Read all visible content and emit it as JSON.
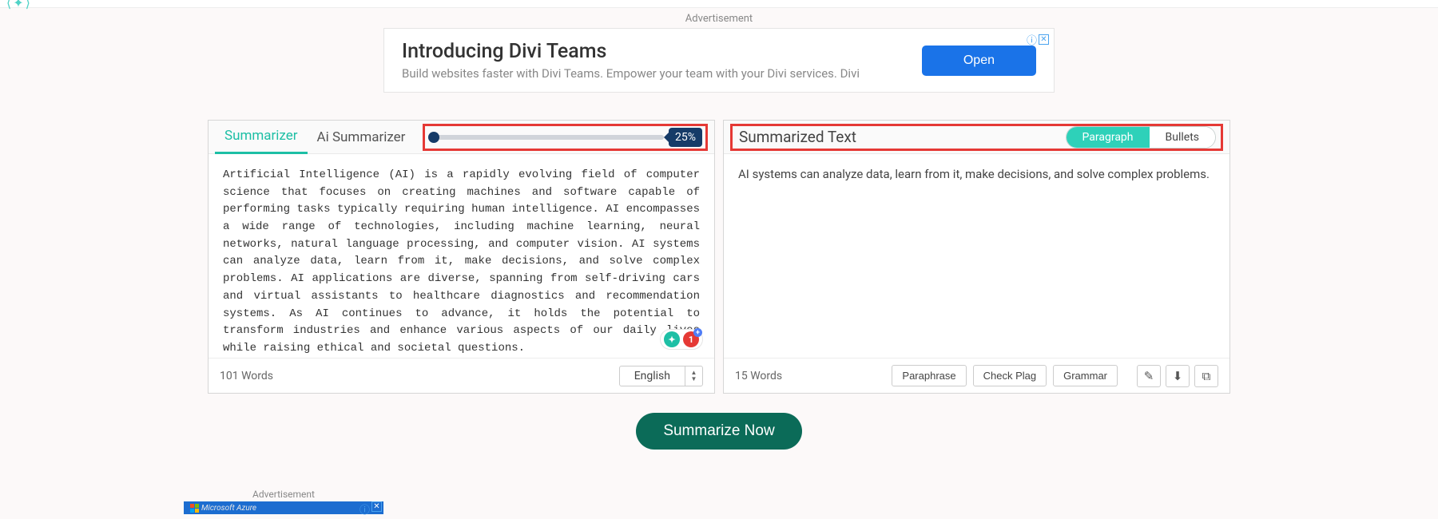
{
  "topAd": {
    "label": "Advertisement",
    "title": "Introducing Divi Teams",
    "subtitle": "Build websites faster with Divi Teams. Empower your team with your Divi services. Divi",
    "cta": "Open"
  },
  "leftPanel": {
    "tabs": {
      "summarizer": "Summarizer",
      "ai": "Ai Summarizer"
    },
    "sliderPercent": "25%",
    "sourceText": "Artificial Intelligence (AI) is a rapidly evolving field of computer science that focuses on creating machines and software capable of performing tasks typically requiring human intelligence. AI encompasses a wide range of technologies, including machine learning, neural networks, natural language processing, and computer vision. AI systems can analyze data, learn from it, make decisions, and solve complex problems. AI applications are diverse, spanning from self-driving cars and virtual assistants to healthcare diagnostics and recommendation systems. As AI continues to advance, it holds the potential to transform industries and enhance various aspects of our daily lives while raising ethical and societal questions.",
    "wordCount": "101 Words",
    "language": "English",
    "badgeGreen": "✦",
    "badgeRed": "1"
  },
  "rightPanel": {
    "title": "Summarized Text",
    "toggle": {
      "paragraph": "Paragraph",
      "bullets": "Bullets"
    },
    "summaryText": "AI systems can analyze data, learn from it, make decisions, and solve complex problems.",
    "wordCount": "15 Words",
    "actions": {
      "paraphrase": "Paraphrase",
      "checkPlag": "Check Plag",
      "grammar": "Grammar"
    }
  },
  "cta": "Summarize Now",
  "bottomAd": {
    "label": "Advertisement",
    "brand": "Microsoft Azure"
  }
}
